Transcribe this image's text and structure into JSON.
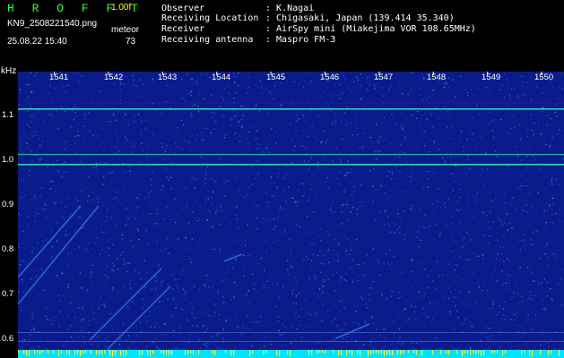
{
  "header": {
    "app_title": "H R O F F T",
    "version": "1.00f",
    "filename": "KN9_2508221540.png",
    "meteor_label": "meteor",
    "datetime": "25.08.22 15:40",
    "meteor_count": "73"
  },
  "info": [
    {
      "label": "Observer",
      "value": ": K.Nagai"
    },
    {
      "label": "Receiving Location",
      "value": ": Chigasaki, Japan (139.414 35.340)"
    },
    {
      "label": "Receiver",
      "value": ": AirSpy mini (Miakejima VOR 108.65MHz)"
    },
    {
      "label": "Receiving antenna",
      "value": ": Maspro FM-3"
    }
  ],
  "axes": {
    "y_unit": "kHz",
    "y_ticks": [
      "1.1",
      "1.0",
      "0.9",
      "0.8",
      "0.7",
      "0.6"
    ],
    "x_ticks": [
      "1541",
      "1542",
      "1543",
      "1544",
      "1545",
      "1546",
      "1547",
      "1548",
      "1549",
      "1550"
    ]
  },
  "colors": {
    "background": "#000000",
    "waterfall_base": "#0a1c8c",
    "signal_line": "#2dd4b0",
    "bottom_band": "#00e5ff",
    "title_green": "#33ff33",
    "version_yellow": "#ffff00"
  }
}
